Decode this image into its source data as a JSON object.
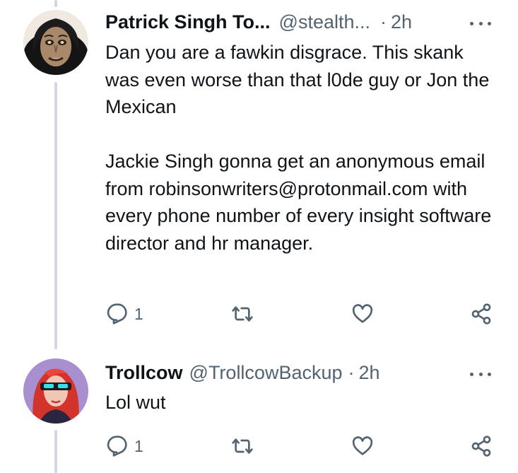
{
  "tweets": [
    {
      "display_name": "Patrick Singh To...",
      "handle": "@stealth...",
      "separator": "·",
      "time": "2h",
      "body": [
        "Dan you are a fawkin disgrace. This skank was even worse than that l0de guy or Jon the Mexican",
        "Jackie Singh gonna get an anonymous email from robinsonwriters@protonmail.com with every phone number of every insight software director and hr manager."
      ],
      "reply_count": "1",
      "icons": {
        "more": "more-horizontal-icon",
        "reply": "reply-icon",
        "retweet": "retweet-icon",
        "like": "heart-icon",
        "share": "share-icon"
      }
    },
    {
      "display_name": "Trollcow",
      "handle": "@TrollcowBackup",
      "separator": "·",
      "time": "2h",
      "body": [
        "Lol wut"
      ],
      "reply_count": "1",
      "icons": {
        "more": "more-horizontal-icon",
        "reply": "reply-icon",
        "retweet": "retweet-icon",
        "like": "heart-icon",
        "share": "share-icon"
      }
    }
  ],
  "colors": {
    "text_primary": "#0f1419",
    "text_secondary": "#536471",
    "thread_line": "#cfd9de",
    "background": "#ffffff"
  }
}
